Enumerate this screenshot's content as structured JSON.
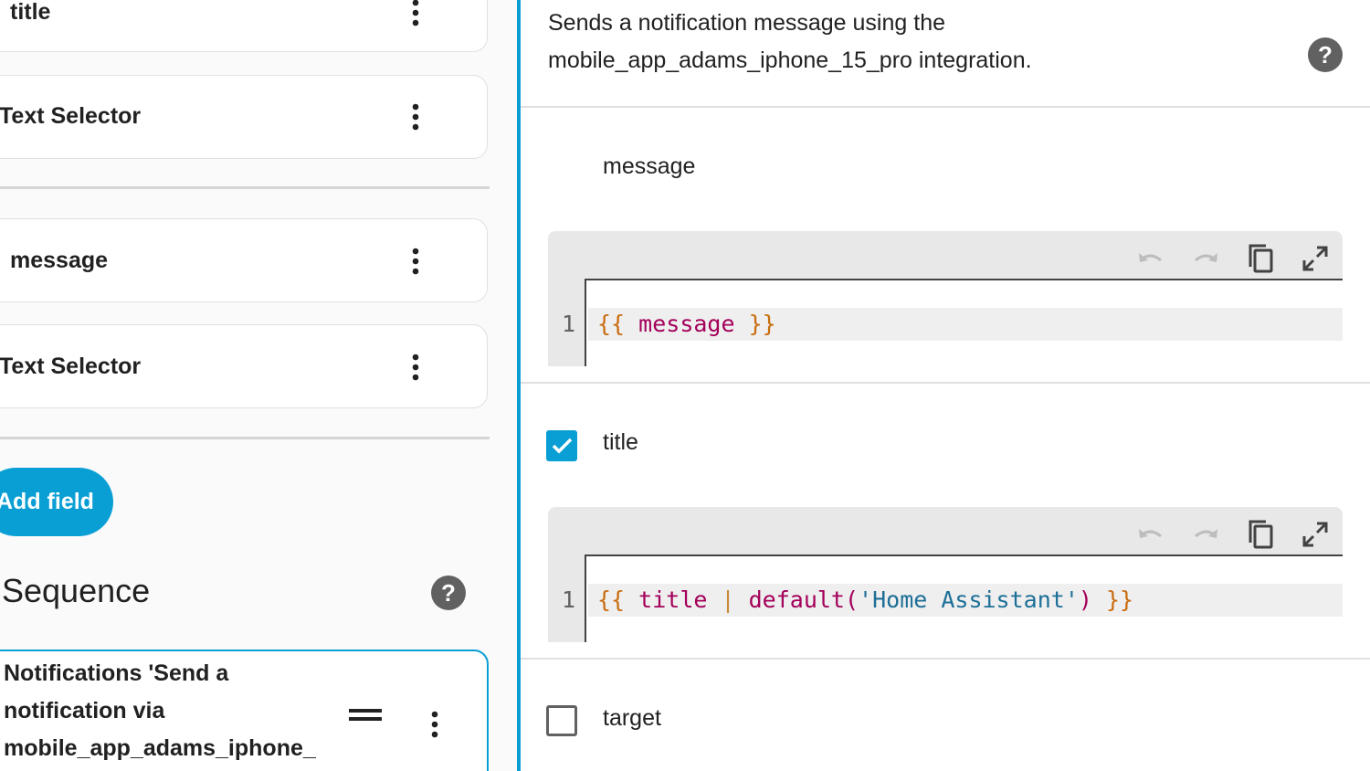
{
  "left": {
    "cards": [
      {
        "label": "title"
      },
      {
        "label": "Text Selector"
      },
      {
        "label": "message"
      },
      {
        "label": "Text Selector"
      }
    ],
    "add_field_label": "Add field",
    "sequence_title": "Sequence",
    "action_card": {
      "text": "Notifications 'Send a notification via mobile_app_adams_iphone_"
    }
  },
  "right": {
    "description": "Sends a notification message using the mobile_app_adams_iphone_15_pro integration.",
    "fields": [
      {
        "label": "message",
        "checked": null,
        "line_number": "1"
      },
      {
        "label": "title",
        "checked": true,
        "line_number": "1"
      },
      {
        "label": "target",
        "checked": false
      }
    ],
    "code": {
      "message": {
        "open": "{{",
        "var": "message",
        "close": "}}"
      },
      "title": {
        "open": "{{",
        "var": "title",
        "pipe": "|",
        "func": "default(",
        "str": "'Home Assistant'",
        "paren": ")",
        "close": "}}"
      }
    }
  },
  "colors": {
    "accent": "#0a9fd4",
    "brace": "#c96d10",
    "variable": "#a3005a",
    "string": "#1c6f97"
  }
}
